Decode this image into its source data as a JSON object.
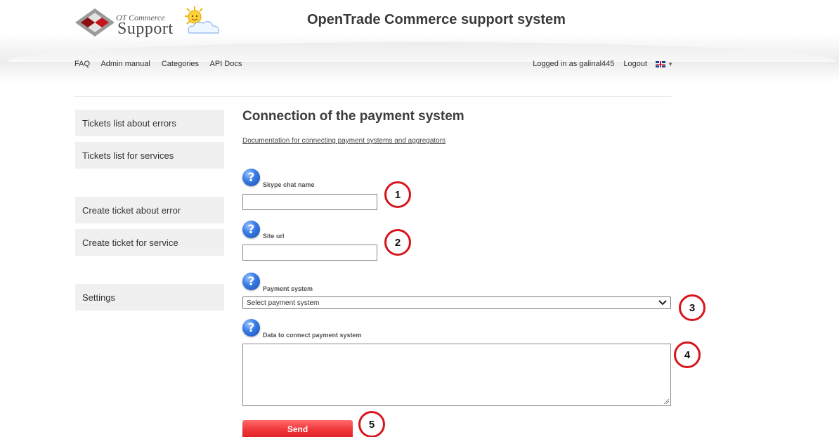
{
  "header": {
    "logo_top": "OT Commerce",
    "logo_main": "Support",
    "site_title": "OpenTrade Commerce support system"
  },
  "topnav": {
    "items": [
      "FAQ",
      "Admin manual",
      "Categories",
      "API Docs"
    ],
    "logged_in": "Logged in as galinal445",
    "logout": "Logout"
  },
  "sidebar": {
    "items": [
      "Tickets list about errors",
      "Tickets list for services",
      "Create ticket about error",
      "Create ticket for service",
      "Settings"
    ]
  },
  "main": {
    "title": "Connection of the payment system",
    "doc_link": "Documentation for connecting payment systems and aggregators",
    "fields": {
      "skype_label": "Skype chat name",
      "skype_value": "",
      "site_label": "Site url",
      "site_value": "",
      "payment_label": "Payment system",
      "payment_selected": "Select payment system",
      "data_label": "Data to connect payment system",
      "data_value": ""
    },
    "help_glyph": "?",
    "send": "Send"
  },
  "callouts": [
    "1",
    "2",
    "3",
    "4",
    "5"
  ],
  "colors": {
    "send_button": "#e8262b",
    "callout_ring": "#d8141b",
    "help_icon": "#2f6fd8",
    "sidebar_bg": "#f0f0f0"
  }
}
